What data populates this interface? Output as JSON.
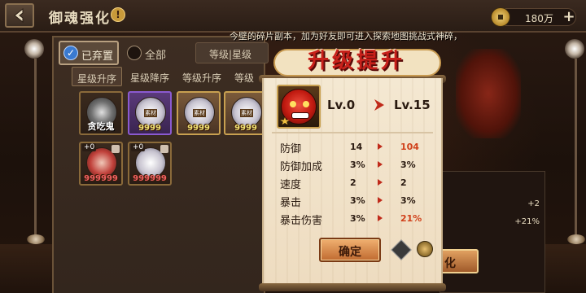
{
  "header": {
    "title": "御魂强化",
    "info_symbol": "!",
    "currency_value": "180万",
    "plus_symbol": "+"
  },
  "notice": "今壁的碎片副本，加为好友即可进入探索地图挑战式神碎，",
  "filters": {
    "abandoned_label": "已弃置",
    "all_label": "全部",
    "level_label": "等级|星级"
  },
  "sort_tabs": [
    "星级升序",
    "星级降序",
    "等级升序",
    "等级"
  ],
  "cards_row1": [
    {
      "style": "gray",
      "name": "贪吃鬼",
      "count": ""
    },
    {
      "style": "white",
      "tag": "素材",
      "count": "9999",
      "frame": "purple"
    },
    {
      "style": "white",
      "tag": "素材",
      "count": "9999",
      "frame": "gold"
    },
    {
      "style": "white",
      "tag": "素材",
      "count": "9999",
      "frame": "gold"
    }
  ],
  "cards_row2": [
    {
      "style": "red",
      "plus": "+0",
      "count": "999999"
    },
    {
      "style": "white",
      "plus": "+0",
      "count": "999999"
    }
  ],
  "dialog": {
    "title": "升级提升",
    "level_from": "Lv.0",
    "level_to": "Lv.15",
    "stats": [
      {
        "name": "防御",
        "old": "14",
        "new": "104",
        "up": true
      },
      {
        "name": "防御加成",
        "old": "3%",
        "new": "3%",
        "up": false
      },
      {
        "name": "速度",
        "old": "2",
        "new": "2",
        "up": false
      },
      {
        "name": "暴击",
        "old": "3%",
        "new": "3%",
        "up": false
      },
      {
        "name": "暴击伤害",
        "old": "3%",
        "new": "21%",
        "up": true
      }
    ],
    "confirm_label": "确定"
  },
  "right_panel": {
    "stat_a": "+2",
    "stat_b": "+21%",
    "button_label": "化"
  }
}
